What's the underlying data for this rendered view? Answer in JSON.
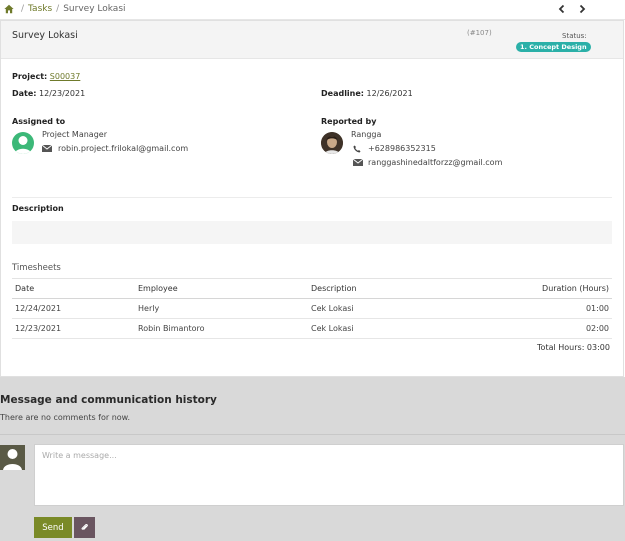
{
  "breadcrumb": {
    "tasks": "Tasks",
    "separator": "/",
    "current": "Survey Lokasi"
  },
  "task": {
    "title": "Survey Lokasi",
    "id": "(#107)",
    "status_label": "Status:",
    "status_value": "1. Concept Design"
  },
  "details": {
    "project_label": "Project:",
    "project_value": "S00037",
    "date_label": "Date:",
    "date_value": "12/23/2021",
    "deadline_label": "Deadline:",
    "deadline_value": "12/26/2021",
    "assigned_label": "Assigned to",
    "assignee_name": "Project Manager",
    "assignee_email": "robin.project.frilokal@gmail.com",
    "reported_label": "Reported by",
    "reporter_name": "Rangga",
    "reporter_phone": "+628986352315",
    "reporter_email": "ranggashinedaltforzz@gmail.com",
    "description_label": "Description"
  },
  "timesheets": {
    "label": "Timesheets",
    "columns": [
      "Date",
      "Employee",
      "Description",
      "Duration (Hours)"
    ],
    "rows": [
      [
        "12/24/2021",
        "Herly",
        "Cek Lokasi",
        "01:00"
      ],
      [
        "12/23/2021",
        "Robin Bimantoro",
        "Cek Lokasi",
        "02:00"
      ]
    ],
    "total": "Total Hours: 03:00"
  },
  "comments": {
    "title": "Message and communication history",
    "empty_text": "There are no comments for now.",
    "placeholder": "Write a message...",
    "send_label": "Send"
  },
  "colors": {
    "accent": "#7a8a27",
    "status_badge": "#2bb0a8",
    "link": "#6f7a2b"
  },
  "icons": [
    "home-icon",
    "chevron-left-icon",
    "chevron-right-icon",
    "envelope-icon",
    "phone-icon",
    "user-avatar-icon",
    "paperclip-icon"
  ]
}
